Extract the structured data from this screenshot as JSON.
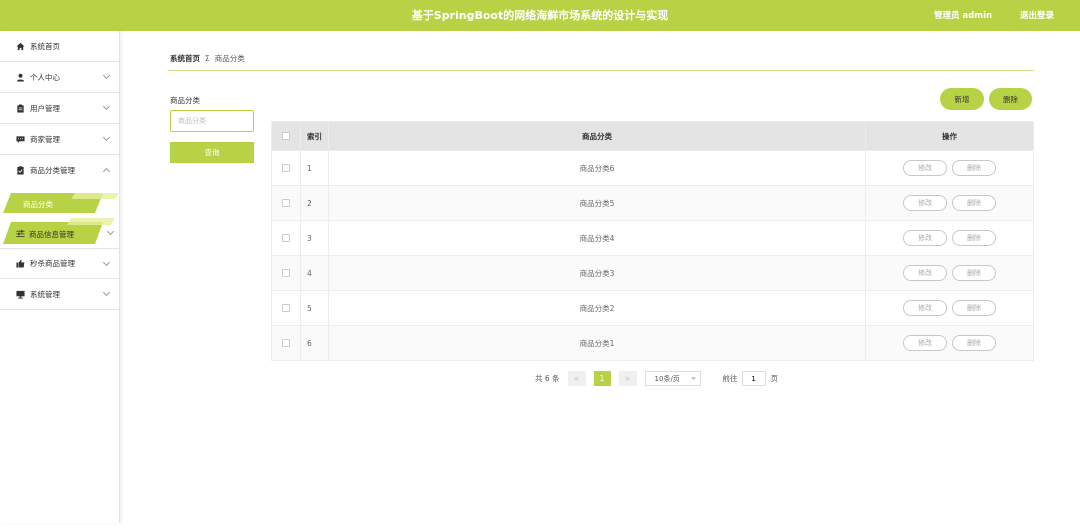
{
  "header": {
    "title": "基于SpringBoot的网络海鲜市场系统的设计与实现",
    "user": "管理员 admin",
    "logout": "退出登录",
    "accent_color": "#b7d245"
  },
  "sidebar": {
    "items": [
      {
        "label": "系统首页",
        "icon": "home-icon"
      },
      {
        "label": "个人中心",
        "icon": "user-icon"
      },
      {
        "label": "用户管理",
        "icon": "clipboard-icon"
      },
      {
        "label": "商家管理",
        "icon": "chat-icon"
      },
      {
        "label": "商品分类管理",
        "icon": "document-icon"
      },
      {
        "label": "商品分类",
        "icon": ""
      },
      {
        "label": "商品信息管理",
        "icon": "sliders-icon"
      },
      {
        "label": "秒杀商品管理",
        "icon": "thumb-icon"
      },
      {
        "label": "系统管理",
        "icon": "monitor-icon"
      }
    ]
  },
  "breadcrumb": {
    "home": "系统首页",
    "separator": "Σ",
    "current": "商品分类"
  },
  "search": {
    "label": "商品分类",
    "placeholder": "商品分类",
    "button": "查询"
  },
  "toolbar": {
    "add": "新增",
    "delete": "删除"
  },
  "table": {
    "headers": {
      "index": "索引",
      "name": "商品分类",
      "ops": "操作"
    },
    "rows": [
      {
        "index": "1",
        "name": "商品分类6"
      },
      {
        "index": "2",
        "name": "商品分类5"
      },
      {
        "index": "3",
        "name": "商品分类4"
      },
      {
        "index": "4",
        "name": "商品分类3"
      },
      {
        "index": "5",
        "name": "商品分类2"
      },
      {
        "index": "6",
        "name": "商品分类1"
      }
    ],
    "edit_label": "修改",
    "delete_label": "删除"
  },
  "pagination": {
    "total": "共 6 条",
    "prev": "<",
    "page": "1",
    "next": ">",
    "page_size": "10条/页",
    "goto_label": "前往",
    "goto_value": "1",
    "page_suffix": "页"
  }
}
